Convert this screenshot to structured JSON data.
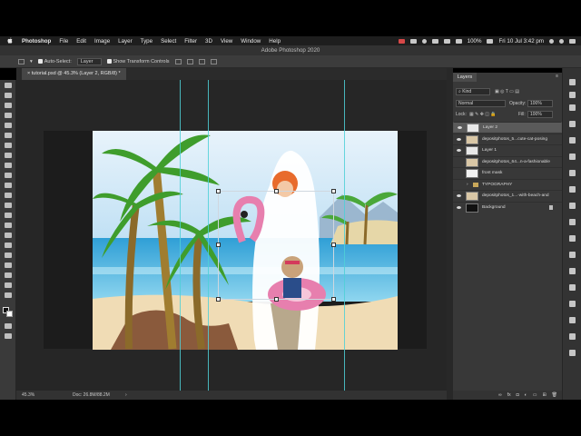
{
  "menubar": {
    "app_name": "Photoshop",
    "items": [
      "File",
      "Edit",
      "Image",
      "Layer",
      "Type",
      "Select",
      "Filter",
      "3D",
      "View",
      "Window",
      "Help"
    ],
    "battery": "100%",
    "clock": "Fri 10 Jul  3:42 pm"
  },
  "window": {
    "title": "Adobe Photoshop 2020"
  },
  "options": {
    "auto_select_label": "Auto-Select:",
    "auto_select_value": "Layer",
    "show_transform_label": "Show Transform Controls"
  },
  "document": {
    "tab_label": "tutorial.psd @ 45.3% (Layer 2, RGB/8) *"
  },
  "status": {
    "zoom": "45.3%",
    "doc_info": "Doc: 26.8M/88.2M"
  },
  "layers_panel": {
    "tab": "Layers",
    "filter_kind": "Kind",
    "blend_mode": "Normal",
    "opacity_label": "Opacity:",
    "opacity_value": "100%",
    "lock_label": "Lock:",
    "fill_label": "Fill:",
    "fill_value": "100%",
    "layers": [
      {
        "name": "Layer 2",
        "visible": true,
        "selected": true,
        "kind": "pixel"
      },
      {
        "name": "depositphotos_5...cute-cat-posing",
        "visible": true,
        "selected": false,
        "kind": "image"
      },
      {
        "name": "Layer 1",
        "visible": true,
        "selected": false,
        "kind": "pixel"
      },
      {
        "name": "depositphotos_64...n-a-fashionable",
        "visible": false,
        "selected": false,
        "kind": "image"
      },
      {
        "name": "front mask",
        "visible": false,
        "selected": false,
        "kind": "mask"
      },
      {
        "name": "TYPOGRAPHY",
        "visible": false,
        "selected": false,
        "kind": "group"
      },
      {
        "name": "depositphotos_1...-with-beach-and",
        "visible": true,
        "selected": false,
        "kind": "image"
      },
      {
        "name": "Background",
        "visible": true,
        "selected": false,
        "kind": "background"
      }
    ]
  },
  "colors": {
    "guide": "#4fd0d7",
    "sky": "#cfe6f6",
    "sea": "#4fb6df",
    "sand": "#f0dcb5",
    "palm_leaf": "#3f9d2c",
    "flamingo": "#e77fae",
    "panel_bg": "#383838"
  }
}
